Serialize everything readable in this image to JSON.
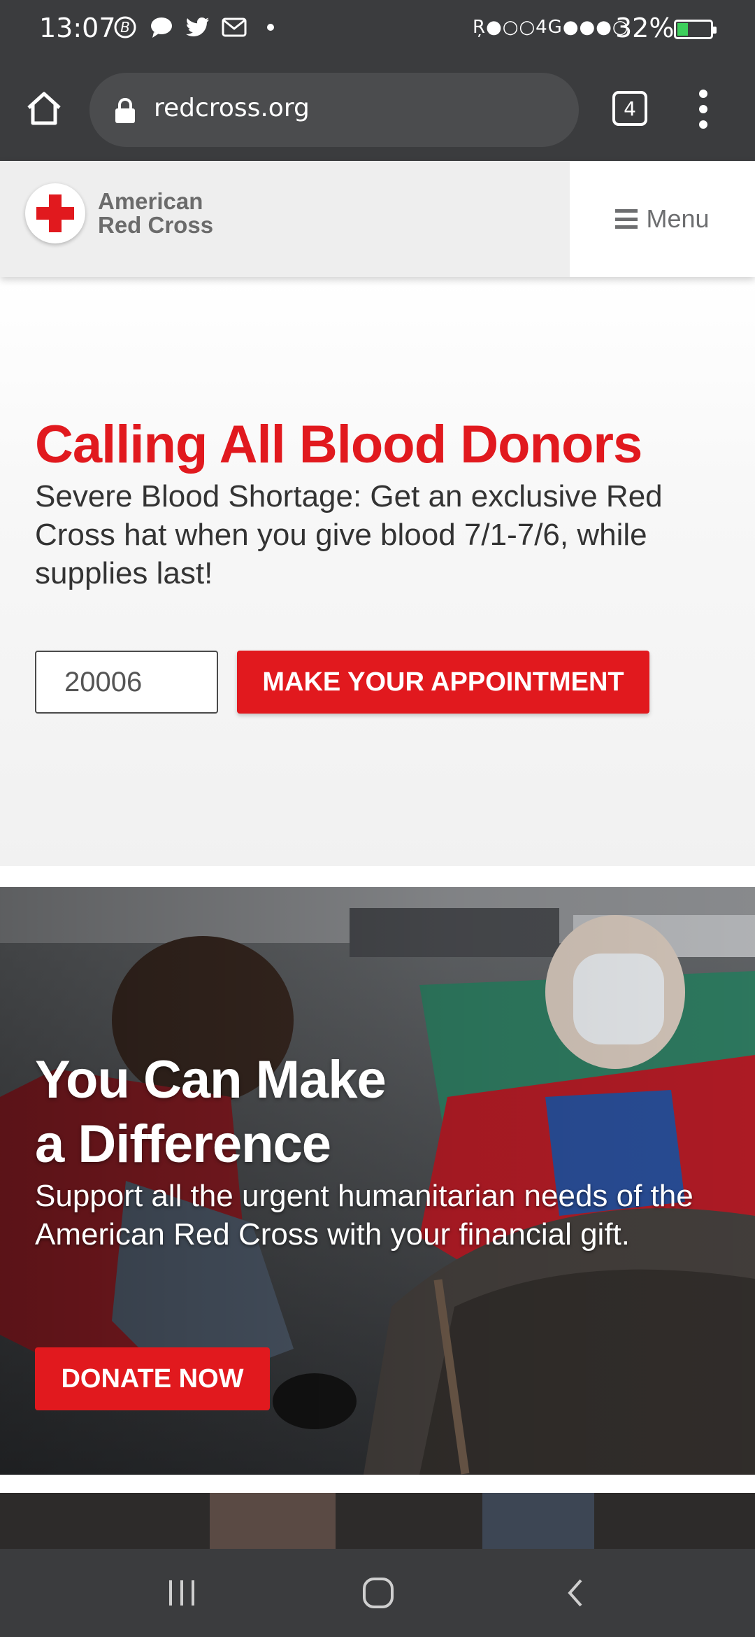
{
  "status_bar": {
    "time": "13:07",
    "signal_text": "Ŗ●○○4G●●●○",
    "battery_percent": "32%",
    "battery_level": 0.32,
    "notification_icons": [
      "b-circle-icon",
      "chat-bubble-icon",
      "twitter-icon",
      "gmail-icon",
      "dot-icon"
    ]
  },
  "browser": {
    "url": "redcross.org",
    "tab_count": "4"
  },
  "site_header": {
    "logo_line1": "American",
    "logo_line2": "Red Cross",
    "menu_label": "Menu"
  },
  "hero_blood": {
    "title": "Calling All Blood Donors",
    "description": "Severe Blood Shortage: Get an exclusive Red Cross hat when you give blood 7/1-7/6, while supplies last!",
    "zip_value": "20006",
    "cta_label": "MAKE YOUR APPOINTMENT"
  },
  "hero_donate": {
    "title": "You Can Make a Difference",
    "description": "Support all the urgent humanitarian needs of the American Red Cross with your financial gift.",
    "cta_label": "DONATE NOW"
  },
  "colors": {
    "brand_red": "#e1191e",
    "chrome_dark": "#3b3c3e",
    "header_grey": "#eeeeee"
  }
}
